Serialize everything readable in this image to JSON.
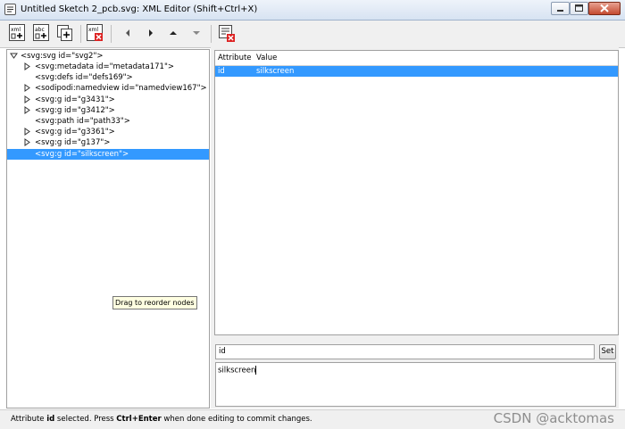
{
  "window": {
    "title": "Untitled Sketch 2_pcb.svg: XML Editor (Shift+Ctrl+X)"
  },
  "toolbar": {
    "buttons": [
      {
        "name": "new-element-node",
        "icon": "xml-new-element-icon"
      },
      {
        "name": "new-text-node",
        "icon": "abc-new-text-icon"
      },
      {
        "name": "duplicate-node",
        "icon": "duplicate-node-icon"
      },
      {
        "name": "delete-node",
        "icon": "xml-delete-icon"
      }
    ],
    "arrows": [
      "unindent",
      "indent",
      "raise",
      "lower"
    ],
    "delete_attribute_icon": "delete-attribute-icon"
  },
  "tree": {
    "root": "<svg:svg id=\"svg2\">",
    "nodes": [
      {
        "label": "<svg:metadata id=\"metadata171\">",
        "expandable": true
      },
      {
        "label": "<svg:defs id=\"defs169\">",
        "expandable": false
      },
      {
        "label": "<sodipodi:namedview id=\"namedview167\">",
        "expandable": true
      },
      {
        "label": "<svg:g id=\"g3431\">",
        "expandable": true
      },
      {
        "label": "<svg:g id=\"g3412\">",
        "expandable": true
      },
      {
        "label": "<svg:path id=\"path33\">",
        "expandable": false
      },
      {
        "label": "<svg:g id=\"g3361\">",
        "expandable": true
      },
      {
        "label": "<svg:g id=\"g137\">",
        "expandable": true
      },
      {
        "label": "<svg:g id=\"silkscreen\">",
        "expandable": false,
        "selected": true
      }
    ]
  },
  "tooltip": "Drag to reorder nodes",
  "attributes": {
    "headers": {
      "attribute": "Attribute",
      "value": "Value"
    },
    "rows": [
      {
        "attribute": "id",
        "value": "silkscreen",
        "selected": true
      }
    ]
  },
  "editor": {
    "name_value": "id",
    "set_label": "Set",
    "value_text": "silkscreen"
  },
  "status": {
    "prefix": "Attribute ",
    "attr": "id",
    "mid": " selected. Press ",
    "shortcut": "Ctrl+Enter",
    "suffix": " when done editing to commit changes."
  },
  "watermark": "CSDN @acktomas",
  "colors": {
    "selection": "#3399ff"
  }
}
